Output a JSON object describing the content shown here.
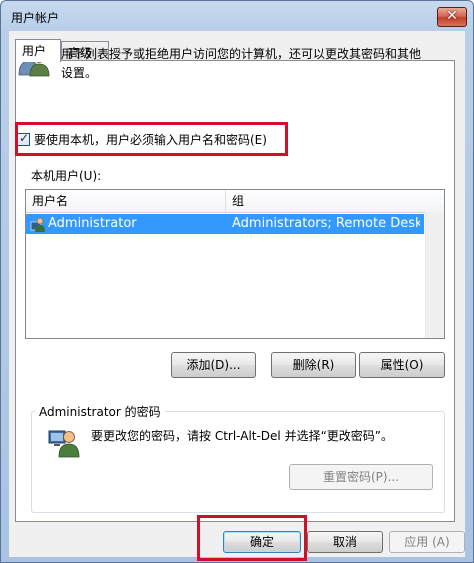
{
  "window": {
    "title": "用户帐户",
    "close_glyph": "✕"
  },
  "tabs": [
    {
      "label": "用户",
      "active": true
    },
    {
      "label": "高级",
      "active": false
    }
  ],
  "intro": {
    "icon": "users-icon",
    "text": "用下列表授予或拒绝用户访问您的计算机，还可以更改其密码和其他设置。"
  },
  "require_login": {
    "label": "要使用本机，用户必须输入用户名和密码(E)",
    "checked": true
  },
  "local_users": {
    "label": "本机用户(U):",
    "columns": [
      "用户名",
      "组"
    ],
    "rows": [
      {
        "name": "Administrator",
        "group": "Administrators; Remote Deskt..."
      }
    ]
  },
  "user_buttons": {
    "add": "添加(D)...",
    "remove": "删除(R)",
    "properties": "属性(O)"
  },
  "password_group": {
    "title": "Administrator 的密码",
    "text": "要更改您的密码，请按 Ctrl-Alt-Del 并选择“更改密码”。",
    "reset_button": "重置密码(P)..."
  },
  "dialog_buttons": {
    "ok": "确定",
    "cancel": "取消",
    "apply": "应用 (A)"
  },
  "colors": {
    "selection": "#3399ff",
    "highlight_box": "#d0102a"
  }
}
